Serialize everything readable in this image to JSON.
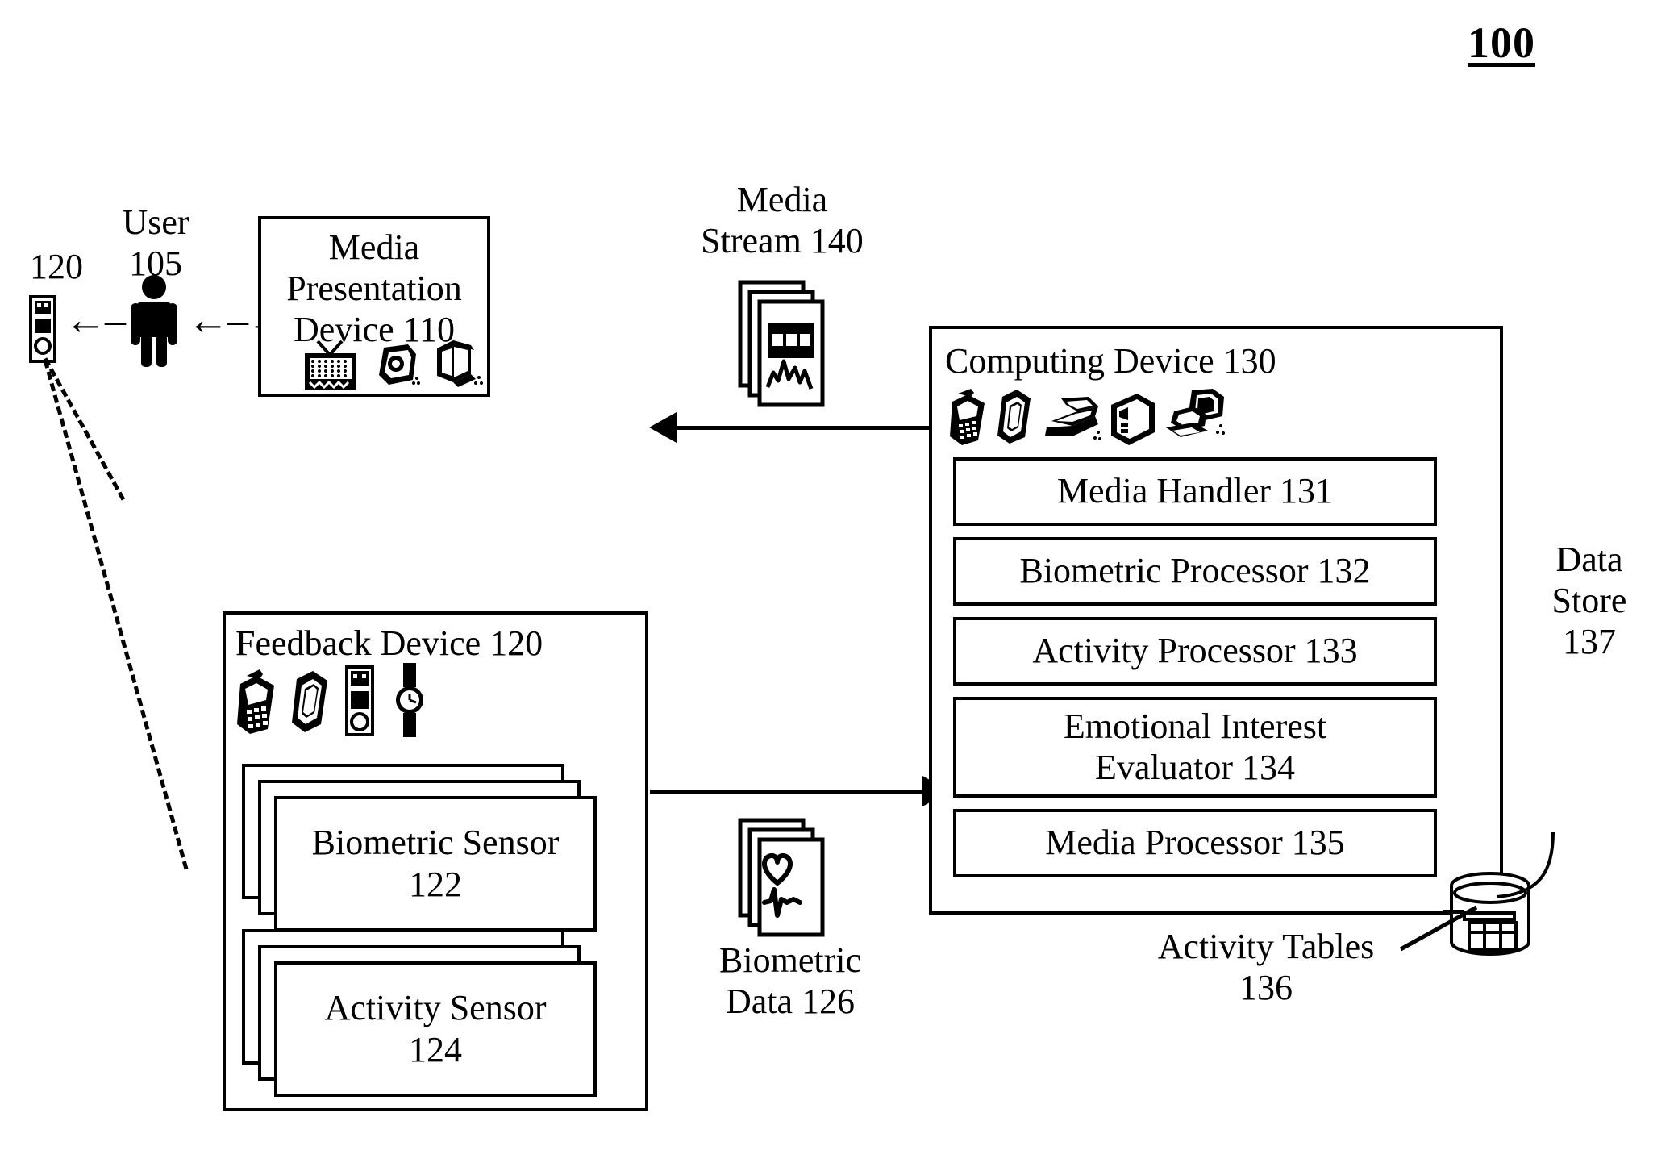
{
  "figure": {
    "number": "100"
  },
  "user": {
    "label": "User\n105",
    "icon": "person-icon",
    "arrow_left": "←–→",
    "arrow_right": "←–→"
  },
  "remote": {
    "label": "120",
    "icon": "remote-control-icon"
  },
  "media_presentation": {
    "title": "Media\nPresentation\nDevice 110",
    "icons": [
      "television-icon",
      "camera-icon",
      "book-icon"
    ]
  },
  "media_stream": {
    "label": "Media\nStream 140",
    "icon": "media-document-stack-icon"
  },
  "biometric_data": {
    "label": "Biometric\nData 126",
    "icon": "biometric-document-stack-icon"
  },
  "feedback_device": {
    "title": "Feedback Device 120",
    "icons": [
      "mobile-phone-icon",
      "pda-icon",
      "remote-control-icon",
      "wristwatch-icon"
    ],
    "sensors": [
      {
        "label": "Biometric Sensor\n122"
      },
      {
        "label": "Activity Sensor\n124"
      }
    ]
  },
  "computing_device": {
    "title": "Computing Device 130",
    "icons": [
      "mobile-phone-icon",
      "pda-icon",
      "laptop-icon",
      "tower-icon",
      "desktop-computer-icon"
    ],
    "modules": [
      {
        "label": "Media Handler 131"
      },
      {
        "label": "Biometric Processor 132"
      },
      {
        "label": "Activity Processor 133"
      },
      {
        "label": "Emotional Interest\nEvaluator 134"
      },
      {
        "label": "Media Processor 135"
      }
    ]
  },
  "data_store": {
    "label": "Data\nStore\n137",
    "icon": "database-cylinder-icon"
  },
  "activity_tables": {
    "label": "Activity Tables\n136"
  },
  "colors": {
    "ink": "#000000",
    "paper": "#ffffff"
  }
}
